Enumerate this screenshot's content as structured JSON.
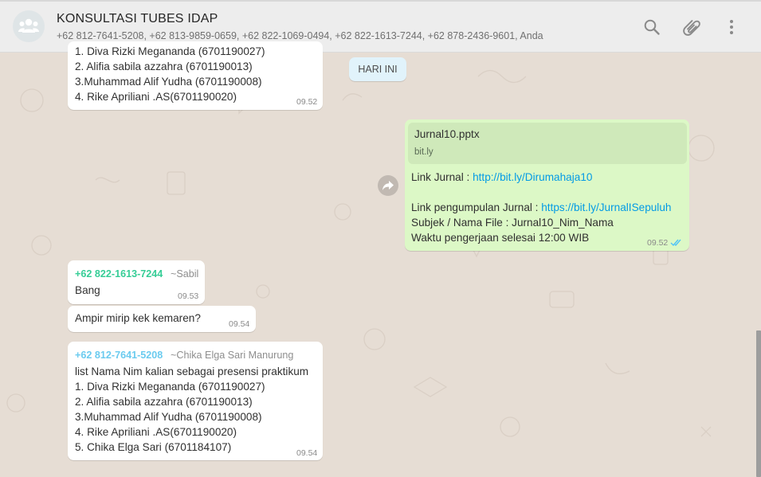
{
  "header": {
    "title": "KONSULTASI TUBES IDAP",
    "members": "+62 812-7641-5208, +62 813-9859-0659, +62 822-1069-0494, +62 822-1613-7244, +62 878-2436-9601, Anda",
    "icons": [
      "group-avatar-icon",
      "search-icon",
      "attach-icon",
      "menu-icon"
    ]
  },
  "date_divider": "HARI INI",
  "messages": {
    "m1": {
      "lines": [
        "1. Diva Rizki Meganandа (6701190027)",
        "2. Alifia sabila azzahra (6701190013)",
        "3.Muhammad Alif Yudha (6701190008)",
        "4. Rike Apriliani .AS(6701190020)"
      ],
      "time": "09.52"
    },
    "m2": {
      "file_name": "Jurnal10.pptx",
      "file_host": "bit.ly",
      "link_label": "Link Jurnal : ",
      "link_url": "http://bit.ly/Dirumahaja10",
      "collect_label": "Link pengumpulan Jurnal : ",
      "collect_url": "https://bit.ly/JurnalISepuluh",
      "subject": "Subjek / Nama File : Jurnal10_Nim_Nama",
      "deadline": "Waktu pengerjaan selesai 12:00 WIB",
      "time": "09.52",
      "status": "read"
    },
    "m3": {
      "sender": "+62 822-1613-7244",
      "pushname": "~Sabil",
      "text": "Bang",
      "time": "09.53"
    },
    "m4": {
      "text": "Ampir mirip kek kemaren?",
      "time": "09.54"
    },
    "m5": {
      "sender": "+62 812-7641-5208",
      "pushname": "~Chika Elga Sari Manurung",
      "lines": [
        "list Nama Nim kalian sebagai presensi praktikum",
        "1. Diva Rizki Meganandа (6701190027)",
        "2. Alifia sabila azzahra (6701190013)",
        "3.Muhammad Alif Yudha (6701190008)",
        "4. Rike Apriliani .AS(6701190020)",
        "5. Chika Elga  Sari (6701184107)"
      ],
      "time": "09.54"
    }
  },
  "colors": {
    "sender_a": "#35cd96",
    "sender_b": "#6bcbef",
    "link": "#039be5",
    "outgoing_bubble": "#dcf8c6",
    "read_ticks": "#4fc3f7"
  }
}
